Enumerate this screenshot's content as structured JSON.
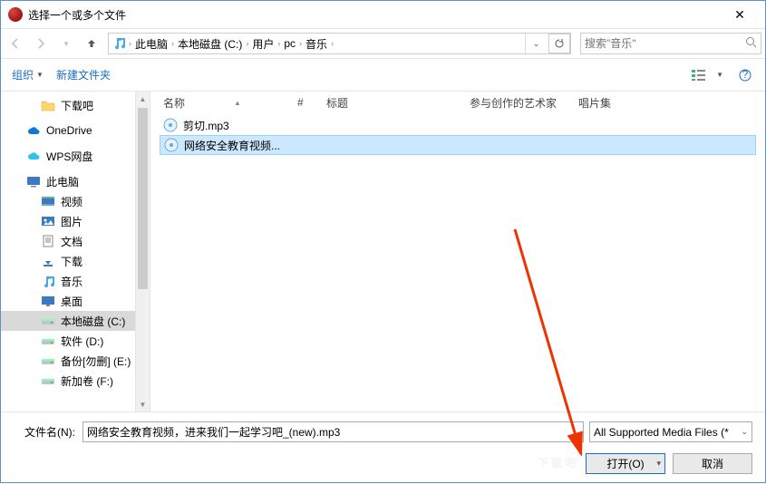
{
  "title": "选择一个或多个文件",
  "breadcrumb": [
    "此电脑",
    "本地磁盘 (C:)",
    "用户",
    "pc",
    "音乐"
  ],
  "search_placeholder": "搜索\"音乐\"",
  "toolbar": {
    "organize": "组织",
    "new_folder": "新建文件夹"
  },
  "columns": {
    "name": "名称",
    "num": "#",
    "title": "标题",
    "artist": "参与创作的艺术家",
    "album": "唱片集"
  },
  "files": [
    {
      "name": "剪切.mp3",
      "selected": false
    },
    {
      "name": "网络安全教育视频...",
      "selected": true
    }
  ],
  "tree": [
    {
      "label": "下载吧",
      "icon": "folder",
      "indent": 1
    },
    {
      "label": "OneDrive",
      "icon": "cloud-blue",
      "indent": 0,
      "gapBefore": true
    },
    {
      "label": "WPS网盘",
      "icon": "cloud-lt",
      "indent": 0,
      "gapBefore": true
    },
    {
      "label": "此电脑",
      "icon": "pc",
      "indent": 0,
      "gapBefore": true
    },
    {
      "label": "视频",
      "icon": "video",
      "indent": 1
    },
    {
      "label": "图片",
      "icon": "image",
      "indent": 1
    },
    {
      "label": "文档",
      "icon": "doc",
      "indent": 1
    },
    {
      "label": "下载",
      "icon": "download",
      "indent": 1
    },
    {
      "label": "音乐",
      "icon": "music",
      "indent": 1
    },
    {
      "label": "桌面",
      "icon": "desktop",
      "indent": 1
    },
    {
      "label": "本地磁盘 (C:)",
      "icon": "drive",
      "indent": 1,
      "selected": true
    },
    {
      "label": "软件 (D:)",
      "icon": "drive",
      "indent": 1
    },
    {
      "label": "备份[勿删] (E:)",
      "icon": "drive",
      "indent": 1
    },
    {
      "label": "新加卷 (F:)",
      "icon": "drive",
      "indent": 1
    }
  ],
  "filename_label": "文件名(N):",
  "filename_value": "网络安全教育视频，进来我们一起学习吧_(new).mp3",
  "filter": "All Supported Media Files (*",
  "open_btn": "打开(O)",
  "cancel_btn": "取消",
  "watermark": "下载吧"
}
